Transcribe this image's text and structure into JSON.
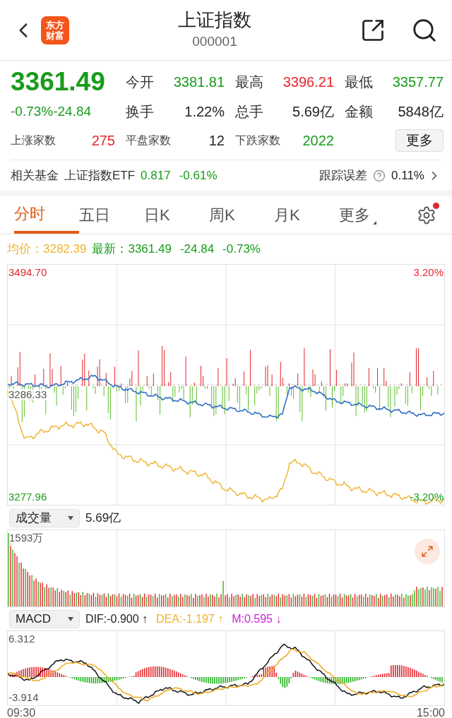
{
  "header": {
    "logo_lines": [
      "东方",
      "财富"
    ],
    "title": "上证指数",
    "code": "000001"
  },
  "quote": {
    "price": "3361.49",
    "color": "#189c1c",
    "change_pct": "-0.73%",
    "change": "-24.84",
    "stats": [
      {
        "label": "今开",
        "value": "3381.81",
        "color": "#189c1c"
      },
      {
        "label": "最高",
        "value": "3396.21",
        "color": "#e3262d"
      },
      {
        "label": "最低",
        "value": "3357.77",
        "color": "#189c1c"
      },
      {
        "label": "换手",
        "value": "1.22%",
        "color": "#222222"
      },
      {
        "label": "总手",
        "value": "5.69亿",
        "color": "#222222"
      },
      {
        "label": "金额",
        "value": "5848亿",
        "color": "#222222"
      }
    ],
    "breadth": [
      {
        "label": "上涨家数",
        "value": "275",
        "color": "#e3262d"
      },
      {
        "label": "平盘家数",
        "value": "12",
        "color": "#222222"
      },
      {
        "label": "下跌家数",
        "value": "2022",
        "color": "#189c1c"
      }
    ],
    "more_button": "更多"
  },
  "fund": {
    "label": "相关基金",
    "name": "上证指数ETF",
    "price": "0.817",
    "change": "-0.61%",
    "color": "#189c1c",
    "tracking_label": "跟踪误差",
    "tracking_value": "0.11%"
  },
  "tabs": [
    {
      "label": "分时",
      "selected": true,
      "dropdown": false
    },
    {
      "label": "五日",
      "selected": false,
      "dropdown": false
    },
    {
      "label": "日K",
      "selected": false,
      "dropdown": false
    },
    {
      "label": "周K",
      "selected": false,
      "dropdown": false
    },
    {
      "label": "月K",
      "selected": false,
      "dropdown": false
    },
    {
      "label": "更多",
      "selected": false,
      "dropdown": true
    }
  ],
  "settings": {
    "notification": true
  },
  "info": {
    "avg_label": "均价：",
    "avg": "3282.39",
    "latest_label": "最新：",
    "latest": "3361.49",
    "change": "-24.84",
    "change_pct": "-0.73%"
  },
  "chart": {
    "y_max": "3494.70",
    "y_min": "3277.96",
    "pct_max": "3.20%",
    "pct_min": "-3.20%",
    "mid": "3286.33"
  },
  "volume": {
    "selector": "成交量",
    "total": "5.69亿",
    "max": "1593万"
  },
  "macd": {
    "selector": "MACD",
    "dif": "DIF:-0.900 ↑",
    "dea": "DEA:-1.197 ↑",
    "m": "M:0.595 ↓",
    "max": "6.312",
    "min": "-3.914"
  },
  "times": [
    "09:30",
    "15:00"
  ]
}
